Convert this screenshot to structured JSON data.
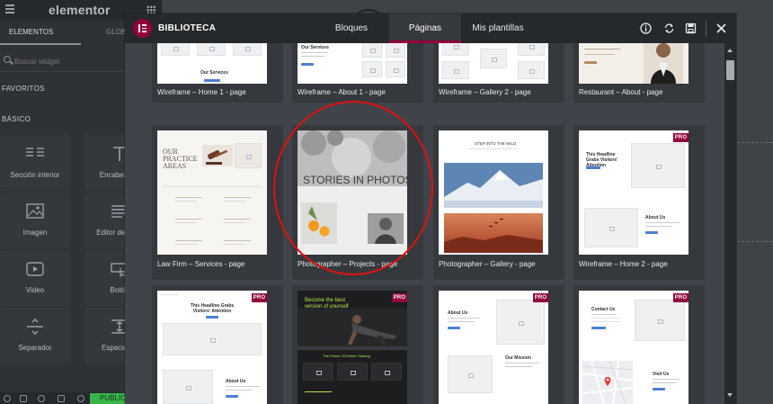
{
  "editor": {
    "brand": "elementor",
    "tabs": [
      "ELEMENTOS",
      "GLOBAL"
    ],
    "search_placeholder": "Buscar widget",
    "sections": [
      "FAVORITOS",
      "BÁSICO"
    ],
    "widgets": [
      "Sección interior",
      "Encabezado",
      "Imagen",
      "Editor de texto",
      "Video",
      "Botón",
      "Separador",
      "Espaciador"
    ],
    "publish_label": "PUBLICAR"
  },
  "modal": {
    "title": "BIBLIOTECA",
    "tabs": [
      "Bloques",
      "Páginas",
      "Mis plantillas"
    ],
    "active_tab": "Páginas",
    "header_icons": [
      "info-icon",
      "sync-icon",
      "save-icon",
      "close-icon"
    ]
  },
  "cards": [
    {
      "label": "Wireframe – Home 1 - page",
      "pro": false,
      "thumb_text": "Our Services"
    },
    {
      "label": "Wireframe – About 1 - page",
      "pro": false,
      "thumb_text": "Our Services"
    },
    {
      "label": "Wireframe – Gallery 2 - page",
      "pro": false
    },
    {
      "label": "Restaurant – About - page",
      "pro": false
    },
    {
      "label": "Law Firm – Services - page",
      "pro": false,
      "thumb_text": "OUR PRACTICE AREAS"
    },
    {
      "label": "Photographer – Projects - page",
      "pro": false,
      "thumb_text": "STORIES IN PHOTOS"
    },
    {
      "label": "Photographer – Gallery - page",
      "pro": false,
      "thumb_text": "STEP INTO THE WILD"
    },
    {
      "label": "Wireframe – Home 2 - page",
      "pro": true,
      "pro_label": "PRO",
      "thumb_text": "This Headline Grabs Visitors' Attention",
      "thumb_text_2": "About Us"
    },
    {
      "pro": true,
      "pro_label": "PRO",
      "thumb_text": "This Headline Grabs Visitors' Attention",
      "thumb_text_2": "About Us"
    },
    {
      "pro": true,
      "pro_label": "PRO",
      "thumb_text": "Become the best version of yourself",
      "thumb_text_2": "The Power Of Online Training"
    },
    {
      "pro": true,
      "pro_label": "PRO",
      "thumb_text": "About Us",
      "thumb_text_2": "Our Mission"
    },
    {
      "pro": true,
      "pro_label": "PRO",
      "thumb_text": "Contact Us",
      "thumb_text_2": "Visit Us"
    }
  ],
  "colors": {
    "accent": "#92003b",
    "modal_bg": "#404349",
    "header_bg": "#26292c",
    "annotation": "#e01010",
    "publish": "#39b54a"
  }
}
